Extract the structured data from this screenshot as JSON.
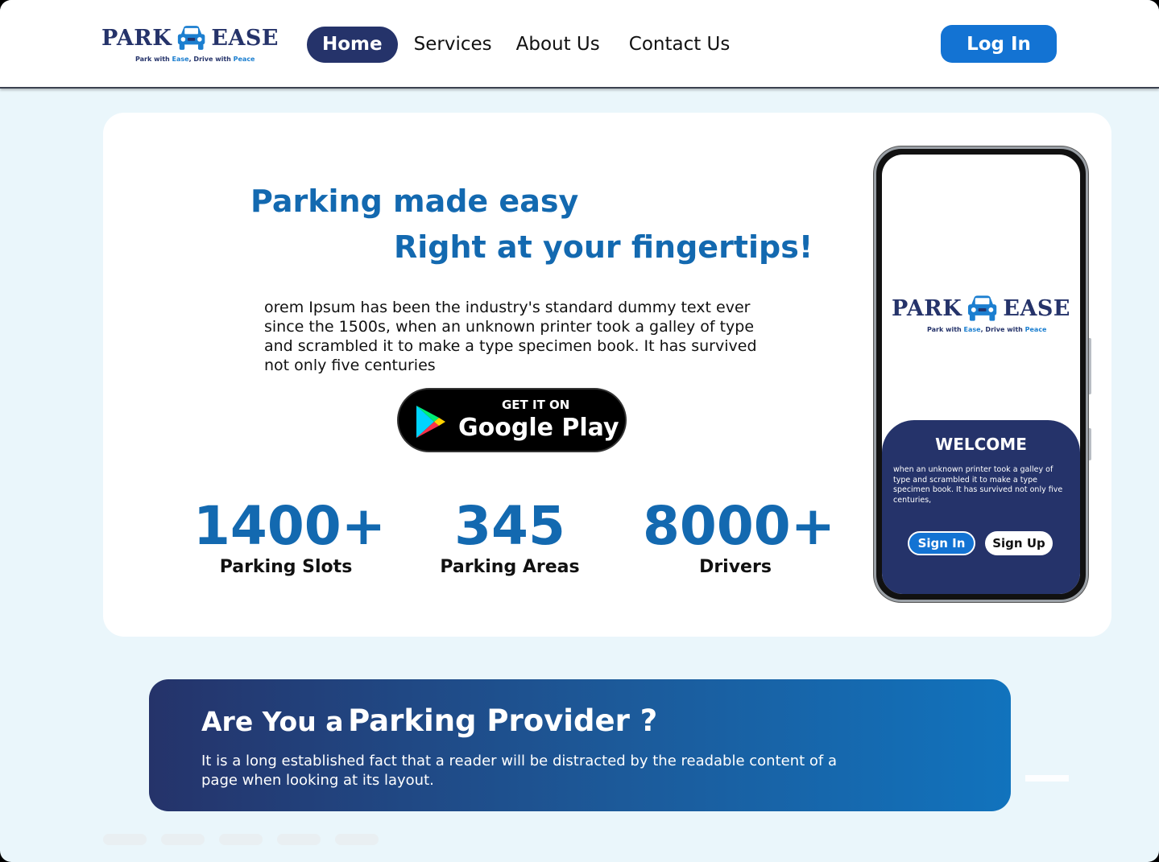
{
  "header": {
    "logo": {
      "word_left": "PARK",
      "word_right": "EASE",
      "tagline_parts": [
        "Park with ",
        "Ease",
        ", Drive with ",
        "Peace"
      ]
    },
    "nav": [
      "Home",
      "Services",
      "About Us",
      "Contact Us"
    ],
    "login_label": "Log In"
  },
  "hero": {
    "headline_1": "Parking made easy",
    "headline_2": "Right at your fingertips!",
    "body": "orem Ipsum has been the industry's standard dummy text ever since the 1500s, when an unknown printer took a galley of type and scrambled it to make a type specimen book. It has survived not only five centuries",
    "google_play": {
      "small": "GET IT ON",
      "big": "Google Play"
    },
    "stats": [
      {
        "value": "1400+",
        "label": "Parking Slots"
      },
      {
        "value": "345",
        "label": "Parking Areas"
      },
      {
        "value": "8000+",
        "label": "Drivers"
      }
    ]
  },
  "phone": {
    "welcome": "WELCOME",
    "text": "when an unknown printer took a galley of type and scrambled it to make a type specimen book. It has survived not only five centuries,",
    "sign_in": "Sign In",
    "sign_up": "Sign Up"
  },
  "provider": {
    "title_small": "Are You a",
    "title_big": "Parking Provider ?",
    "text": "It is a long established fact that a reader will be distracted by the readable content of a page when looking at its layout."
  },
  "colors": {
    "brand_navy": "#25336a",
    "brand_blue": "#1369b0",
    "button_blue": "#1373d3",
    "page_bg": "#eaf6fb"
  },
  "icons": [
    "car-icon",
    "google-play-icon",
    "facebook-icon",
    "instagram-icon",
    "twitter-icon",
    "linkedin-icon",
    "youtube-icon"
  ]
}
